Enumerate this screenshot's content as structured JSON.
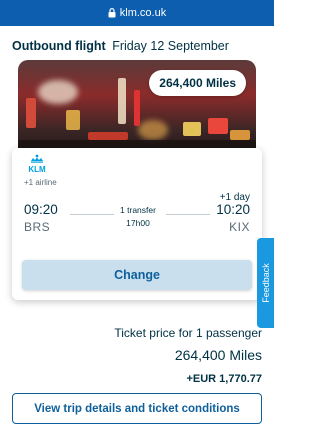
{
  "browser": {
    "url": "klm.co.uk"
  },
  "flight": {
    "heading_label": "Outbound flight",
    "heading_date": "Friday 12 September",
    "miles_badge": "264,400 Miles",
    "airline_logo_text": "KLM",
    "airline_count": "+1 airline",
    "departure_time": "09:20",
    "departure_airport": "BRS",
    "arrival_time": "10:20",
    "arrival_airport": "KIX",
    "arrival_day_offset": "+1 day",
    "transfers": "1 transfer",
    "duration": "17h00",
    "change_label": "Change"
  },
  "price": {
    "label": "Ticket price for 1 passenger",
    "miles": "264,400 Miles",
    "cash": "+EUR 1,770.77"
  },
  "actions": {
    "details_label": "View trip details and ticket conditions",
    "feedback_label": "Feedback"
  },
  "colors": {
    "url_bar": "#0d5eaf",
    "primary_text": "#003145",
    "accent_blue": "#0e5f9b",
    "klm_blue": "#00a1de",
    "change_button_bg": "#c9dfee",
    "feedback_tab": "#1a98e0"
  },
  "icons": {
    "url_lock": "lock-icon",
    "airline": "klm-crown-icon"
  }
}
